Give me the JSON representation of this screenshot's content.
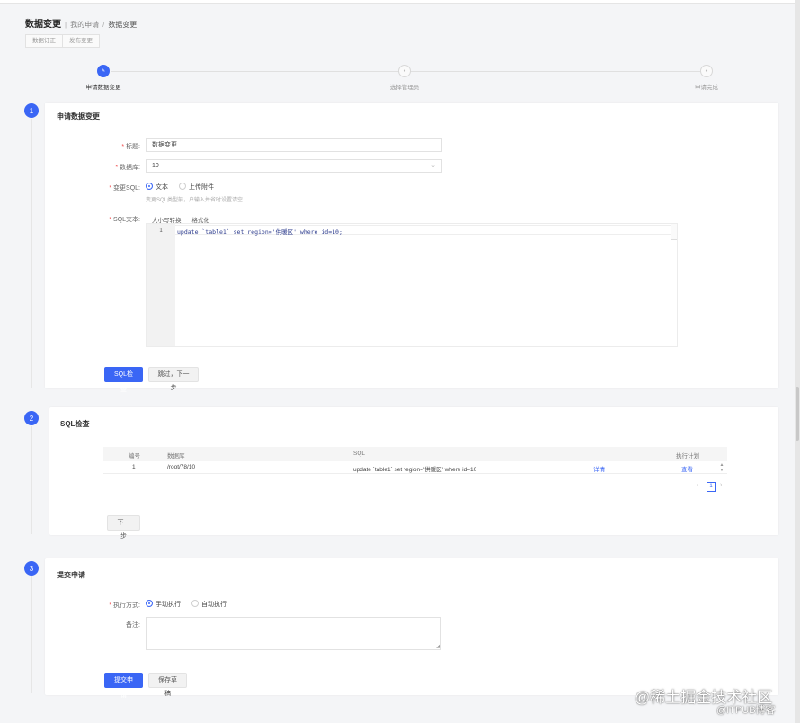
{
  "breadcrumb": {
    "title": "数据变更",
    "items": [
      "我的申请",
      "数据变更"
    ]
  },
  "segment_tabs": [
    "数据订正",
    "发布变更"
  ],
  "steps": [
    {
      "label": "申请数据变更",
      "icon": "edit-icon"
    },
    {
      "label": "选择管理员",
      "icon": "user-icon"
    },
    {
      "label": "申请完成",
      "icon": "check-icon"
    }
  ],
  "section1": {
    "number": "1",
    "title": "申请数据变更",
    "fields": {
      "title_label": "标题:",
      "title_value": "数据变更",
      "db_label": "数据库:",
      "db_value": "10",
      "sql_type_label": "变更SQL:",
      "sql_type_options": [
        "文本",
        "上传附件"
      ],
      "sql_type_selected": "文本",
      "sql_hint": "变更SQL类型前，户输入并省时设置请空",
      "sql_text_label": "SQL文本:",
      "editor_tools": [
        "大小写转换",
        "格式化"
      ],
      "line_number": "1",
      "code_line": "update `table1` set region='供暖区' where id=10;"
    },
    "buttons": {
      "check": "SQL检查",
      "skip": "跳过，下一步"
    }
  },
  "section2": {
    "number": "2",
    "title": "SQL检查",
    "table": {
      "headers": [
        "编号",
        "数据库",
        "SQL",
        "执行计划"
      ],
      "rows": [
        {
          "no": "1",
          "db": "/root/78/10",
          "sql": "update `table1` set region='供暖区' where id=10",
          "detail": "详情",
          "plan": "查看"
        }
      ]
    },
    "pagination": {
      "current": "1"
    },
    "next_button": "下一步"
  },
  "section3": {
    "number": "3",
    "title": "提交申请",
    "exec_label": "执行方式:",
    "exec_options": [
      "手动执行",
      "自动执行"
    ],
    "exec_selected": "手动执行",
    "remark_label": "备注:",
    "remark_value": "",
    "buttons": {
      "submit": "提交申请",
      "draft": "保存草稿"
    }
  },
  "watermark": {
    "line1": "@稀土掘金技术社区",
    "line2": "@ITPUB博客"
  },
  "colors": {
    "accent": "#3a66f5",
    "required": "#f04b4b"
  }
}
